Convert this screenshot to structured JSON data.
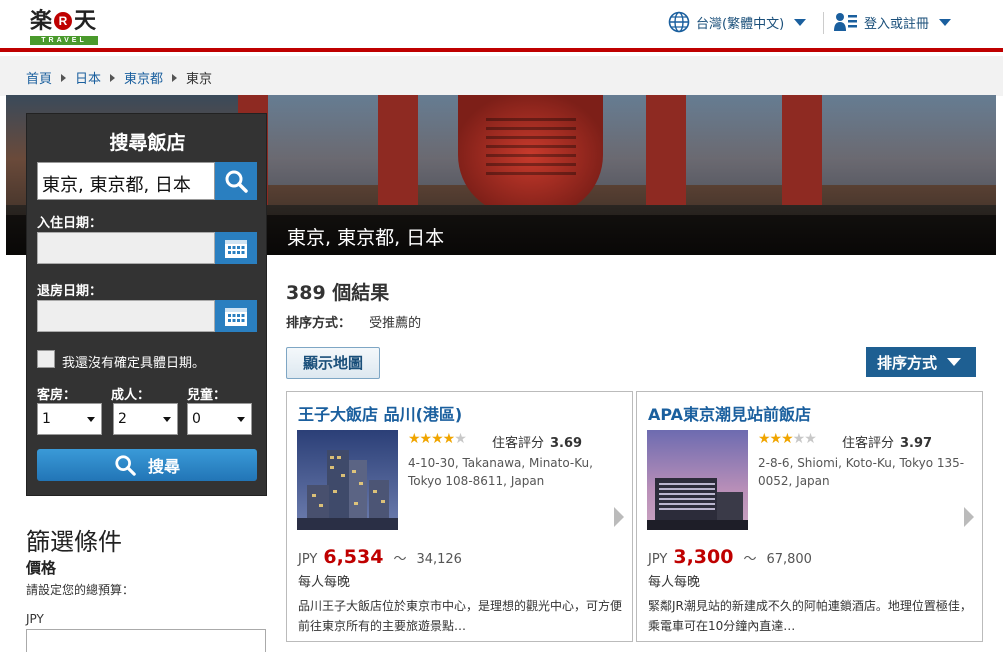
{
  "header": {
    "logo_text_left": "楽",
    "logo_r": "R",
    "logo_text_right": "天",
    "logo_sub": "TRAVEL",
    "language": "台灣(繁體中文)",
    "login": "登入或註冊"
  },
  "breadcrumb": [
    "首頁",
    "日本",
    "東京都",
    "東京"
  ],
  "hero": {
    "caption": "東京, 東京都, 日本"
  },
  "search": {
    "title": "搜尋飯店",
    "destination": "東京, 東京都, 日本",
    "checkin_label": "入住日期：",
    "checkout_label": "退房日期：",
    "checkin_value": "",
    "checkout_value": "",
    "no_dates_label": "我還沒有確定具體日期。",
    "rooms_label": "客房：",
    "adults_label": "成人：",
    "children_label": "兒童：",
    "rooms": "1",
    "adults": "2",
    "children": "0",
    "button": "搜尋"
  },
  "filters": {
    "title": "篩選條件",
    "price_title": "價格",
    "price_hint": "請設定您的總預算：",
    "currency": "JPY"
  },
  "results": {
    "count_text": "389 個結果",
    "sort_label": "排序方式：",
    "sort_value": "受推薦的",
    "map_button": "顯示地圖",
    "sort_button": "排序方式",
    "hotels": [
      {
        "name": "王子大飯店 品川(港區)",
        "stars": 4,
        "rating_label": "住客評分",
        "rating": "3.69",
        "address": "4-10-30, Takanawa, Minato-Ku, Tokyo 108-8611, Japan",
        "currency": "JPY",
        "price_low": "6,534",
        "tilde": "～",
        "price_high": "34,126",
        "per": "每人每晚",
        "desc": "品川王子大飯店位於東京市中心，是理想的觀光中心，可方便前往東京所有的主要旅遊景點…"
      },
      {
        "name": "APA東京潮見站前飯店",
        "stars": 3,
        "rating_label": "住客評分",
        "rating": "3.97",
        "address": "2-8-6, Shiomi, Koto-Ku, Tokyo 135-0052, Japan",
        "currency": "JPY",
        "price_low": "3,300",
        "tilde": "～",
        "price_high": "67,800",
        "per": "每人每晚",
        "desc": "緊鄰JR潮見站的新建成不久的阿帕連鎖酒店。地理位置極佳，乘電車可在10分鐘內直達…"
      }
    ]
  },
  "colors": {
    "brand_red": "#bf0000",
    "link_blue": "#1a5f9e",
    "button_blue": "#2a7fc0",
    "star_gold": "#f0a500"
  }
}
